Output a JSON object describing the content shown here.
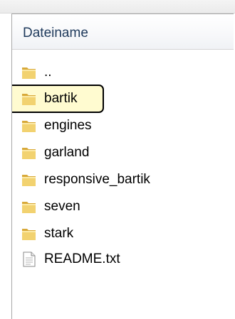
{
  "file_list": {
    "column_header": "Dateiname",
    "items": [
      {
        "name": "..",
        "type": "folder",
        "icon": "folder-icon"
      },
      {
        "name": "bartik",
        "type": "folder",
        "icon": "folder-icon",
        "selected": true
      },
      {
        "name": "engines",
        "type": "folder",
        "icon": "folder-icon"
      },
      {
        "name": "garland",
        "type": "folder",
        "icon": "folder-icon"
      },
      {
        "name": "responsive_bartik",
        "type": "folder",
        "icon": "folder-icon"
      },
      {
        "name": "seven",
        "type": "folder",
        "icon": "folder-icon"
      },
      {
        "name": "stark",
        "type": "folder",
        "icon": "folder-icon"
      },
      {
        "name": "README.txt",
        "type": "file",
        "icon": "text-file-icon"
      }
    ]
  },
  "colors": {
    "header_text": "#1e395b",
    "selection_fill": "#fffbd0",
    "selection_border": "#000000",
    "folder": "#e8c45a"
  }
}
